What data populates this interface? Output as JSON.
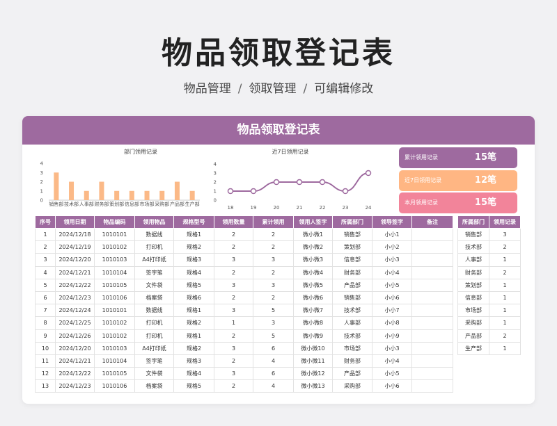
{
  "page": {
    "title": "物品领取登记表",
    "subtitle": [
      "物品管理",
      "领取管理",
      "可编辑修改"
    ],
    "separator": "/"
  },
  "card": {
    "title": "物品领取登记表"
  },
  "colors": {
    "accent": "#9e6a9f",
    "orange": "#ffb683",
    "pink": "#f2849a",
    "bar": "#fbb987",
    "line": "#9e6a9f"
  },
  "stats": [
    {
      "label": "累计领用记录",
      "value": "15笔",
      "color": "#9e6a9f"
    },
    {
      "label": "近7日领用记录",
      "value": "12笔",
      "color": "#ffb683"
    },
    {
      "label": "本月领用记录",
      "value": "15笔",
      "color": "#f2849a"
    }
  ],
  "chart_data": [
    {
      "type": "bar",
      "title": "部门领用记录",
      "categories": [
        "销售部",
        "技术部",
        "人事部",
        "财务部",
        "策划部",
        "信息部",
        "市场部",
        "采购部",
        "产品部",
        "生产部"
      ],
      "values": [
        3,
        2,
        1,
        2,
        1,
        1,
        1,
        1,
        2,
        1
      ],
      "ylim": [
        0,
        4
      ],
      "yticks": [
        "0",
        "1",
        "2",
        "3",
        "4"
      ]
    },
    {
      "type": "line",
      "title": "近7日领用记录",
      "x": [
        "18",
        "19",
        "20",
        "21",
        "22",
        "23",
        "24"
      ],
      "values": [
        1,
        1,
        2,
        2,
        2,
        1,
        3
      ],
      "ylim": [
        0,
        4
      ],
      "yticks": [
        "0",
        "1",
        "2",
        "3",
        "4"
      ]
    }
  ],
  "table": {
    "headers": [
      "序号",
      "领用日期",
      "物品编码",
      "领用物品",
      "规格型号",
      "领用数量",
      "累计领用",
      "领用人签字",
      "所属部门",
      "领导签字",
      "备注"
    ],
    "rows": [
      [
        "1",
        "2024/12/18",
        "1010101",
        "数据线",
        "规格1",
        "2",
        "2",
        "微小微1",
        "销售部",
        "小小1",
        ""
      ],
      [
        "2",
        "2024/12/19",
        "1010102",
        "打印机",
        "规格2",
        "2",
        "2",
        "微小微2",
        "策划部",
        "小小2",
        ""
      ],
      [
        "3",
        "2024/12/20",
        "1010103",
        "A4打印纸",
        "规格3",
        "3",
        "3",
        "微小微3",
        "信息部",
        "小小3",
        ""
      ],
      [
        "4",
        "2024/12/21",
        "1010104",
        "签字笔",
        "规格4",
        "2",
        "2",
        "微小微4",
        "财务部",
        "小小4",
        ""
      ],
      [
        "5",
        "2024/12/22",
        "1010105",
        "文件袋",
        "规格5",
        "3",
        "3",
        "微小微5",
        "产品部",
        "小小5",
        ""
      ],
      [
        "6",
        "2024/12/23",
        "1010106",
        "档案袋",
        "规格6",
        "2",
        "2",
        "微小微6",
        "销售部",
        "小小6",
        ""
      ],
      [
        "7",
        "2024/12/24",
        "1010101",
        "数据线",
        "规格1",
        "3",
        "5",
        "微小微7",
        "技术部",
        "小小7",
        ""
      ],
      [
        "8",
        "2024/12/25",
        "1010102",
        "打印机",
        "规格2",
        "1",
        "3",
        "微小微8",
        "人事部",
        "小小8",
        ""
      ],
      [
        "9",
        "2024/12/26",
        "1010102",
        "打印机",
        "规格1",
        "2",
        "5",
        "微小微9",
        "技术部",
        "小小9",
        ""
      ],
      [
        "10",
        "2024/12/20",
        "1010103",
        "A4打印纸",
        "规格2",
        "3",
        "6",
        "微小微10",
        "市场部",
        "小小3",
        ""
      ],
      [
        "11",
        "2024/12/21",
        "1010104",
        "签字笔",
        "规格3",
        "2",
        "4",
        "微小微11",
        "财务部",
        "小小4",
        ""
      ],
      [
        "12",
        "2024/12/22",
        "1010105",
        "文件袋",
        "规格4",
        "3",
        "6",
        "微小微12",
        "产品部",
        "小小5",
        ""
      ],
      [
        "13",
        "2024/12/23",
        "1010106",
        "档案袋",
        "规格5",
        "2",
        "4",
        "微小微13",
        "采购部",
        "小小6",
        ""
      ]
    ]
  },
  "summary": {
    "headers": [
      "所属部门",
      "领用记录"
    ],
    "rows": [
      [
        "销售部",
        "3"
      ],
      [
        "技术部",
        "2"
      ],
      [
        "人事部",
        "1"
      ],
      [
        "财务部",
        "2"
      ],
      [
        "策划部",
        "1"
      ],
      [
        "信息部",
        "1"
      ],
      [
        "市场部",
        "1"
      ],
      [
        "采购部",
        "1"
      ],
      [
        "产品部",
        "2"
      ],
      [
        "生产部",
        "1"
      ]
    ]
  }
}
